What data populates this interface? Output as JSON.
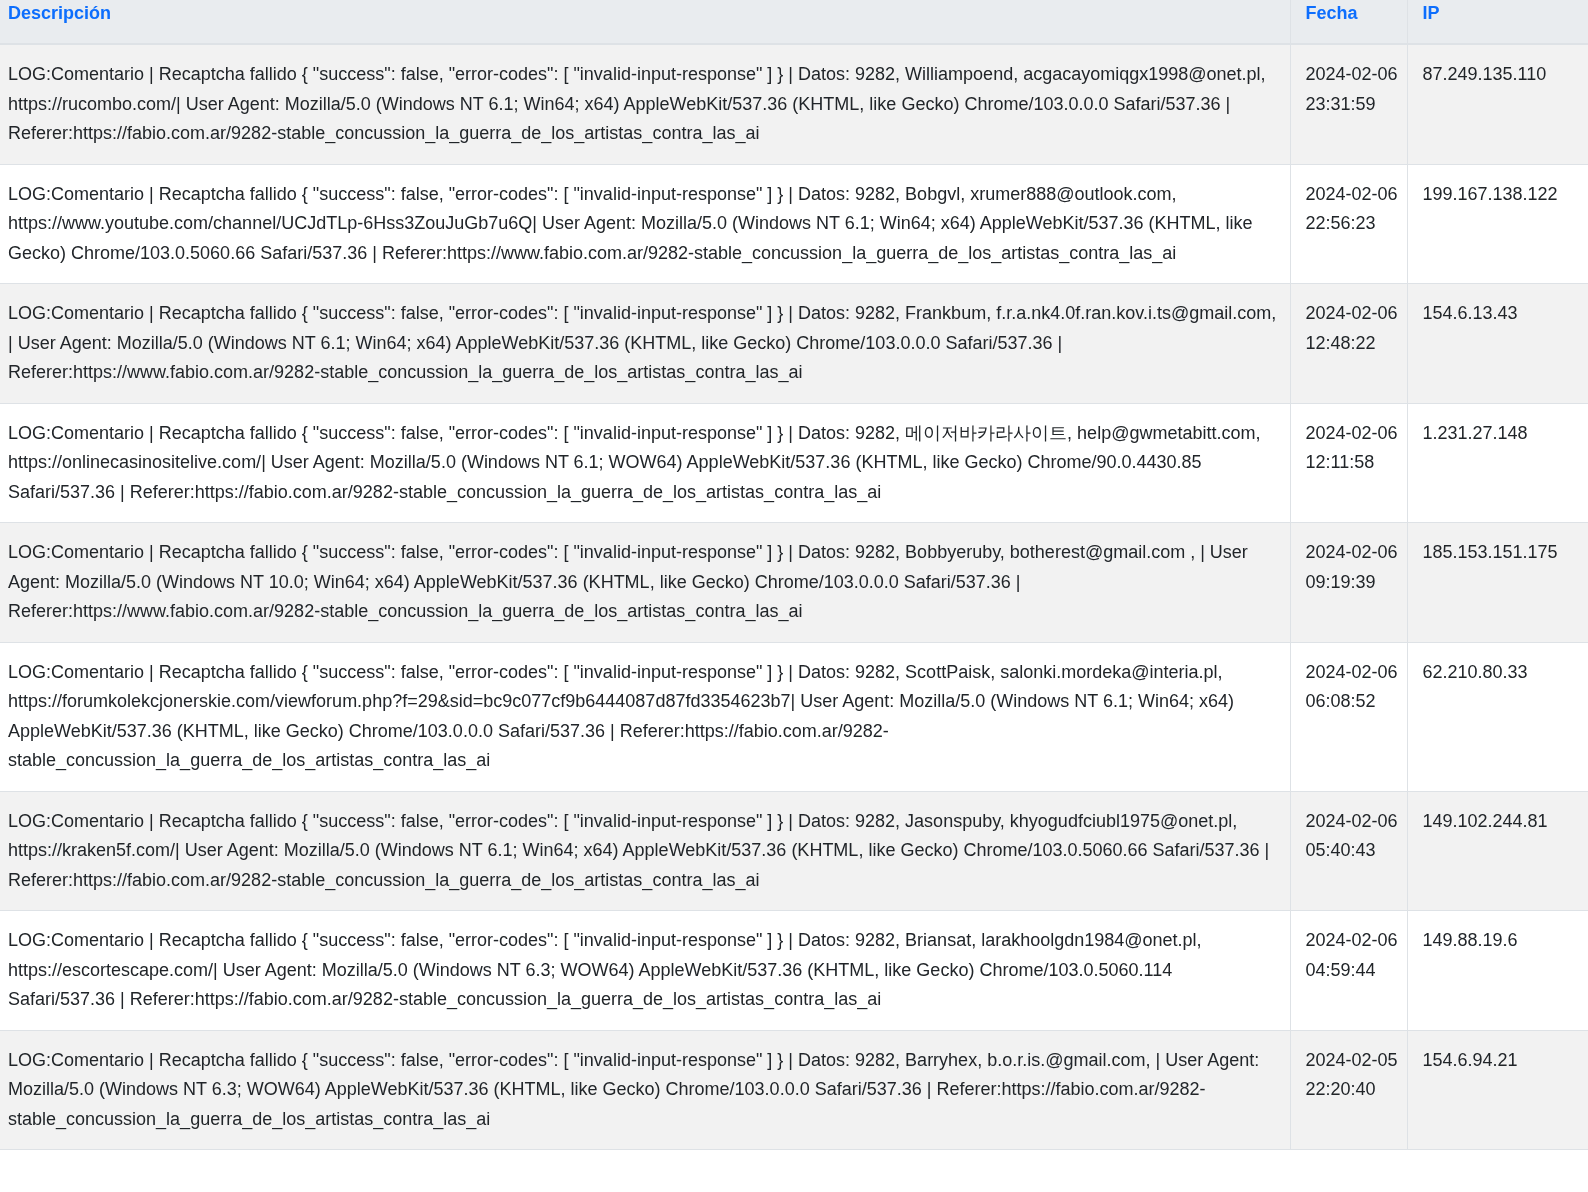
{
  "table": {
    "columns": [
      "Descripción",
      "Fecha",
      "IP"
    ],
    "rows": [
      {
        "description": "LOG:Comentario | Recaptcha fallido { \"success\": false, \"error-codes\": [ \"invalid-input-response\" ] } | Datos: 9282, Williampoend, acgacayomiqgx1998@onet.pl, https://rucombo.com/| User Agent: Mozilla/5.0 (Windows NT 6.1; Win64; x64) AppleWebKit/537.36 (KHTML, like Gecko) Chrome/103.0.0.0 Safari/537.36 | Referer:https://fabio.com.ar/9282-stable_concussion_la_guerra_de_los_artistas_contra_las_ai",
        "date": "2024-02-06 23:31:59",
        "ip": "87.249.135.110"
      },
      {
        "description": "LOG:Comentario | Recaptcha fallido { \"success\": false, \"error-codes\": [ \"invalid-input-response\" ] } | Datos: 9282, Bobgvl, xrumer888@outlook.com, https://www.youtube.com/channel/UCJdTLp-6Hss3ZouJuGb7u6Q| User Agent: Mozilla/5.0 (Windows NT 6.1; Win64; x64) AppleWebKit/537.36 (KHTML, like Gecko) Chrome/103.0.5060.66 Safari/537.36 | Referer:https://www.fabio.com.ar/9282-stable_concussion_la_guerra_de_los_artistas_contra_las_ai",
        "date": "2024-02-06 22:56:23",
        "ip": "199.167.138.122"
      },
      {
        "description": "LOG:Comentario | Recaptcha fallido { \"success\": false, \"error-codes\": [ \"invalid-input-response\" ] } | Datos: 9282, Frankbum, f.r.a.nk4.0f.ran.kov.i.ts@gmail.com, | User Agent: Mozilla/5.0 (Windows NT 6.1; Win64; x64) AppleWebKit/537.36 (KHTML, like Gecko) Chrome/103.0.0.0 Safari/537.36 | Referer:https://www.fabio.com.ar/9282-stable_concussion_la_guerra_de_los_artistas_contra_las_ai",
        "date": "2024-02-06 12:48:22",
        "ip": "154.6.13.43"
      },
      {
        "description": "LOG:Comentario | Recaptcha fallido { \"success\": false, \"error-codes\": [ \"invalid-input-response\" ] } | Datos: 9282, 메이저바카라사이트, help@gwmetabitt.com, https://onlinecasinositelive.com/| User Agent: Mozilla/5.0 (Windows NT 6.1; WOW64) AppleWebKit/537.36 (KHTML, like Gecko) Chrome/90.0.4430.85 Safari/537.36 | Referer:https://fabio.com.ar/9282-stable_concussion_la_guerra_de_los_artistas_contra_las_ai",
        "date": "2024-02-06 12:11:58",
        "ip": "1.231.27.148"
      },
      {
        "description": "LOG:Comentario | Recaptcha fallido { \"success\": false, \"error-codes\": [ \"invalid-input-response\" ] } | Datos: 9282, Bobbyeruby, botherest@gmail.com , | User Agent: Mozilla/5.0 (Windows NT 10.0; Win64; x64) AppleWebKit/537.36 (KHTML, like Gecko) Chrome/103.0.0.0 Safari/537.36 | Referer:https://www.fabio.com.ar/9282-stable_concussion_la_guerra_de_los_artistas_contra_las_ai",
        "date": "2024-02-06 09:19:39",
        "ip": "185.153.151.175"
      },
      {
        "description": "LOG:Comentario | Recaptcha fallido { \"success\": false, \"error-codes\": [ \"invalid-input-response\" ] } | Datos: 9282, ScottPaisk, salonki.mordeka@interia.pl, https://forumkolekcjonerskie.com/viewforum.php?f=29&sid=bc9c077cf9b6444087d87fd3354623b7| User Agent: Mozilla/5.0 (Windows NT 6.1; Win64; x64) AppleWebKit/537.36 (KHTML, like Gecko) Chrome/103.0.0.0 Safari/537.36 | Referer:https://fabio.com.ar/9282-stable_concussion_la_guerra_de_los_artistas_contra_las_ai",
        "date": "2024-02-06 06:08:52",
        "ip": "62.210.80.33"
      },
      {
        "description": "LOG:Comentario | Recaptcha fallido { \"success\": false, \"error-codes\": [ \"invalid-input-response\" ] } | Datos: 9282, Jasonspuby, khyogudfciubl1975@onet.pl, https://kraken5f.com/| User Agent: Mozilla/5.0 (Windows NT 6.1; Win64; x64) AppleWebKit/537.36 (KHTML, like Gecko) Chrome/103.0.5060.66 Safari/537.36 | Referer:https://fabio.com.ar/9282-stable_concussion_la_guerra_de_los_artistas_contra_las_ai",
        "date": "2024-02-06 05:40:43",
        "ip": "149.102.244.81"
      },
      {
        "description": "LOG:Comentario | Recaptcha fallido { \"success\": false, \"error-codes\": [ \"invalid-input-response\" ] } | Datos: 9282, Briansat, larakhoolgdn1984@onet.pl, https://escortescape.com/| User Agent: Mozilla/5.0 (Windows NT 6.3; WOW64) AppleWebKit/537.36 (KHTML, like Gecko) Chrome/103.0.5060.114 Safari/537.36 | Referer:https://fabio.com.ar/9282-stable_concussion_la_guerra_de_los_artistas_contra_las_ai",
        "date": "2024-02-06 04:59:44",
        "ip": "149.88.19.6"
      },
      {
        "description": "LOG:Comentario | Recaptcha fallido { \"success\": false, \"error-codes\": [ \"invalid-input-response\" ] } | Datos: 9282, Barryhex, b.o.r.is.@gmail.com, | User Agent: Mozilla/5.0 (Windows NT 6.3; WOW64) AppleWebKit/537.36 (KHTML, like Gecko) Chrome/103.0.0.0 Safari/537.36 | Referer:https://fabio.com.ar/9282-stable_concussion_la_guerra_de_los_artistas_contra_las_ai",
        "date": "2024-02-05 22:20:40",
        "ip": "154.6.94.21"
      }
    ]
  }
}
